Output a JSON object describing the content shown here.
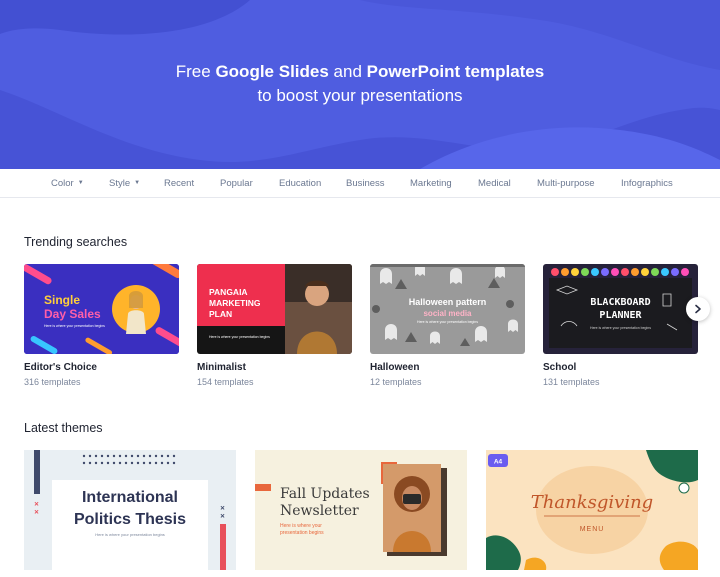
{
  "hero": {
    "line1_pre": "Free ",
    "line1_b1": "Google Slides",
    "line1_mid": " and ",
    "line1_b2": "PowerPoint templates",
    "line2": "to boost your presentations"
  },
  "nav": {
    "items": [
      "Color",
      "Style",
      "Recent",
      "Popular",
      "Education",
      "Business",
      "Marketing",
      "Medical",
      "Multi-purpose",
      "Infographics"
    ]
  },
  "trending": {
    "title": "Trending searches",
    "cards": [
      {
        "name": "Editor's Choice",
        "count": "316 templates",
        "thumb_line1": "Single",
        "thumb_line2": "Day Sales",
        "thumb_sub": "Here is where your presentation begins"
      },
      {
        "name": "Minimalist",
        "count": "154 templates",
        "thumb_line1": "PANGAIA",
        "thumb_line2": "MARKETING",
        "thumb_line3": "PLAN",
        "thumb_sub": "Here is where your presentation begins"
      },
      {
        "name": "Halloween",
        "count": "12 templates",
        "thumb_line1": "Halloween pattern",
        "thumb_line2": "social media",
        "thumb_sub": "Here is where your presentation begins"
      },
      {
        "name": "School",
        "count": "131 templates",
        "thumb_line1": "BLACKBOARD",
        "thumb_line2": "PLANNER",
        "thumb_sub": "Here is where your presentation begins"
      }
    ]
  },
  "latest": {
    "title": "Latest themes",
    "cards": [
      {
        "line1": "International",
        "line2": "Politics Thesis",
        "sub": "Here is where your presentation begins"
      },
      {
        "line1": "Fall Updates",
        "line2": "Newsletter",
        "sub1": "Here is where your",
        "sub2": "presentation begins"
      },
      {
        "badge": "A4",
        "line1": "Thanksgiving",
        "line2": "MENU"
      }
    ]
  },
  "colors": {
    "hero_bg": "#4f5de0",
    "accent": "#5a6cf0"
  }
}
